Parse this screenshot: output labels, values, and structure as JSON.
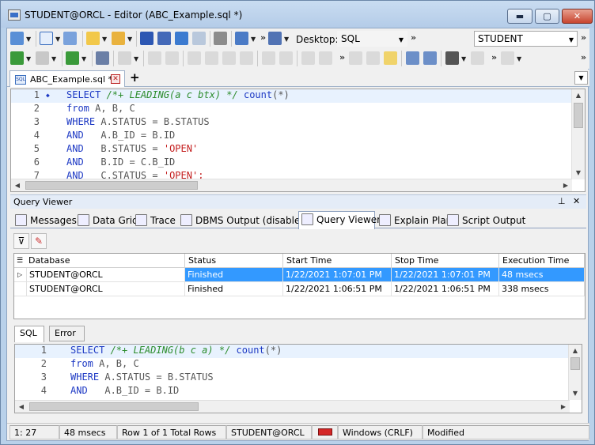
{
  "window": {
    "title": "STUDENT@ORCL - Editor (ABC_Example.sql *)",
    "min_label": "▬",
    "max_label": "▢",
    "close_label": "✕"
  },
  "toolbar": {
    "desktop_label": "Desktop:",
    "desktop_value": "SQL",
    "connection_value": "STUDENT",
    "more": "»"
  },
  "editor_tab": {
    "name": "ABC_Example.sql *",
    "new_tab_label": "+"
  },
  "editor": {
    "lines": [
      {
        "num": "1",
        "marker": "◆",
        "parts": [
          [
            "kw",
            "SELECT "
          ],
          [
            "cm",
            "/*+ LEADING(a c btx) */ "
          ],
          [
            "kw",
            "count"
          ],
          [
            "tx",
            "(*)"
          ]
        ]
      },
      {
        "num": "2",
        "marker": "",
        "parts": [
          [
            "kw",
            "from "
          ],
          [
            "tx",
            "A, B, C"
          ]
        ]
      },
      {
        "num": "3",
        "marker": "",
        "parts": [
          [
            "kw",
            "WHERE "
          ],
          [
            "tx",
            "A.STATUS = B.STATUS"
          ]
        ]
      },
      {
        "num": "4",
        "marker": "",
        "parts": [
          [
            "kw",
            "AND   "
          ],
          [
            "tx",
            "A.B_ID = B.ID"
          ]
        ]
      },
      {
        "num": "5",
        "marker": "",
        "parts": [
          [
            "kw",
            "AND   "
          ],
          [
            "tx",
            "B.STATUS = "
          ],
          [
            "st",
            "'OPEN'"
          ]
        ]
      },
      {
        "num": "6",
        "marker": "",
        "parts": [
          [
            "kw",
            "AND   "
          ],
          [
            "tx",
            "B.ID = C.B_ID"
          ]
        ]
      },
      {
        "num": "7",
        "marker": "",
        "parts": [
          [
            "kw",
            "AND   "
          ],
          [
            "tx",
            "C.STATUS = "
          ],
          [
            "st",
            "'OPEN';"
          ]
        ]
      }
    ]
  },
  "query_viewer": {
    "title": "Query Viewer",
    "pin_icon": "📌",
    "close_icon": "✕",
    "tabs": [
      {
        "label": "Messages",
        "name": "tab-messages"
      },
      {
        "label": "Data Grid",
        "name": "tab-data-grid"
      },
      {
        "label": "Trace",
        "name": "tab-trace"
      },
      {
        "label": "DBMS Output (disabled)",
        "name": "tab-dbms-output"
      },
      {
        "label": "Query Viewer",
        "name": "tab-query-viewer"
      },
      {
        "label": "Explain Plan",
        "name": "tab-explain-plan"
      },
      {
        "label": "Script Output",
        "name": "tab-script-output"
      }
    ],
    "active_tab": 4,
    "grid": {
      "columns": [
        "Database",
        "Status",
        "Start Time",
        "Stop Time",
        "Execution Time"
      ],
      "rows": [
        [
          "STUDENT@ORCL",
          "Finished",
          "1/22/2021 1:07:01 PM",
          "1/22/2021 1:07:01 PM",
          "48 msecs"
        ],
        [
          "STUDENT@ORCL",
          "Finished",
          "1/22/2021 1:06:51 PM",
          "1/22/2021 1:06:51 PM",
          "338 msecs"
        ]
      ],
      "selected_row": 0
    },
    "bottom_tabs": [
      "SQL",
      "Error"
    ],
    "sql_lines": [
      {
        "num": "1",
        "parts": [
          [
            "kw",
            "SELECT "
          ],
          [
            "cm",
            "/*+ LEADING(b c a) */ "
          ],
          [
            "kw",
            "count"
          ],
          [
            "tx",
            "(*)"
          ]
        ]
      },
      {
        "num": "2",
        "parts": [
          [
            "kw",
            "from "
          ],
          [
            "tx",
            "A, B, C"
          ]
        ]
      },
      {
        "num": "3",
        "parts": [
          [
            "kw",
            "WHERE "
          ],
          [
            "tx",
            "A.STATUS = B.STATUS"
          ]
        ]
      },
      {
        "num": "4",
        "parts": [
          [
            "kw",
            "AND   "
          ],
          [
            "tx",
            "A.B_ID = B.ID"
          ]
        ]
      }
    ]
  },
  "status_bar": {
    "position": "1:  27",
    "exec_time": "48 msecs",
    "rows": "Row 1 of 1 Total Rows",
    "connection": "STUDENT@ORCL",
    "line_endings": "Windows (CRLF)",
    "state": "Modified"
  },
  "colors": {
    "selection": "#3399ff",
    "keyword": "#1d39c4",
    "comment": "#2c8c2c",
    "string": "#c41e1e"
  }
}
